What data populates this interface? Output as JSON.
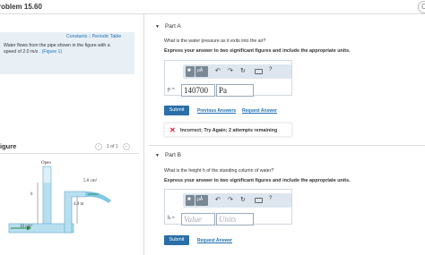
{
  "header": {
    "title": "roblem 15.60"
  },
  "left": {
    "links": {
      "constants": "Constants",
      "separator": "|",
      "periodic": "Periodic Table"
    },
    "problem": {
      "line1": "Water flows from the pipe shown in the figure with a",
      "line2_pre": "speed of 2.0 m/s .",
      "figure_link": "(Figure 1)"
    },
    "figure": {
      "header": "igure",
      "pager": {
        "prev": "‹",
        "count": "1 of 1",
        "next": "›"
      },
      "labels": {
        "open": "Open",
        "area_top": "5.0 cm²",
        "height_h": "h",
        "height_4": "4.0 m",
        "area_bottom": "10 cm²"
      }
    }
  },
  "partA": {
    "label": "Part A",
    "question": "What is the water pressure as it exits into the air?",
    "instruction": "Express your answer to two significant figures and include the appropriate units.",
    "answer": {
      "symbol": "p =",
      "value": "140700",
      "units": "Pa"
    },
    "submit": "Submit",
    "previous_answers": "Previous Answers",
    "request_answer": "Request Answer",
    "feedback": "Incorrect; Try Again; 2 attempts remaining"
  },
  "partB": {
    "label": "Part B",
    "question": "What is the height h of the standing column of water?",
    "instruction": "Express your answer to two significant figures and include the appropriate units.",
    "answer": {
      "symbol": "h =",
      "value_placeholder": "Value",
      "units_placeholder": "Units"
    },
    "submit": "Submit",
    "request_answer": "Request Answer"
  },
  "toolbar": {
    "mu_label": "μÅ",
    "help": "?"
  },
  "colors": {
    "accent": "#2a6fa8",
    "link": "#1a6fb3",
    "error": "#d0202a",
    "toolbar_bg": "#dde6ee"
  }
}
